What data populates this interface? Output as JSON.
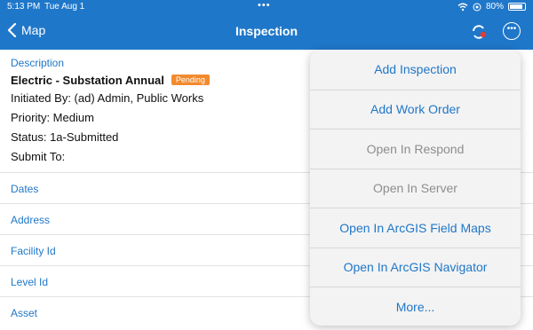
{
  "status_bar": {
    "time": "5:13 PM",
    "date": "Tue Aug 1",
    "battery": "80%"
  },
  "nav": {
    "back_label": "Map",
    "title": "Inspection"
  },
  "description": {
    "label": "Description",
    "title": "Electric - Substation Annual",
    "badge": "Pending",
    "initiated_by": "Initiated By: (ad) Admin, Public Works",
    "priority": "Priority: Medium",
    "status": "Status: 1a-Submitted",
    "submit_to": "Submit To:"
  },
  "rows": [
    {
      "label": "Dates"
    },
    {
      "label": "Address"
    },
    {
      "label": "Facility Id"
    },
    {
      "label": "Level Id"
    },
    {
      "label": "Asset"
    }
  ],
  "menu": {
    "items": [
      {
        "label": "Add Inspection",
        "enabled": true
      },
      {
        "label": "Add Work Order",
        "enabled": true
      },
      {
        "label": "Open In Respond",
        "enabled": false
      },
      {
        "label": "Open In Server",
        "enabled": false
      },
      {
        "label": "Open In ArcGIS Field Maps",
        "enabled": true
      },
      {
        "label": "Open In ArcGIS Navigator",
        "enabled": true
      },
      {
        "label": "More...",
        "enabled": true
      }
    ]
  },
  "colors": {
    "accent": "#1f77c9",
    "badge": "#f28a2e",
    "disabled": "#8e8e8e"
  },
  "icons": {
    "back": "chevron-left-icon",
    "sync": "sync-icon",
    "more": "more-ellipsis-icon",
    "wifi": "wifi-icon",
    "battery": "battery-icon"
  }
}
